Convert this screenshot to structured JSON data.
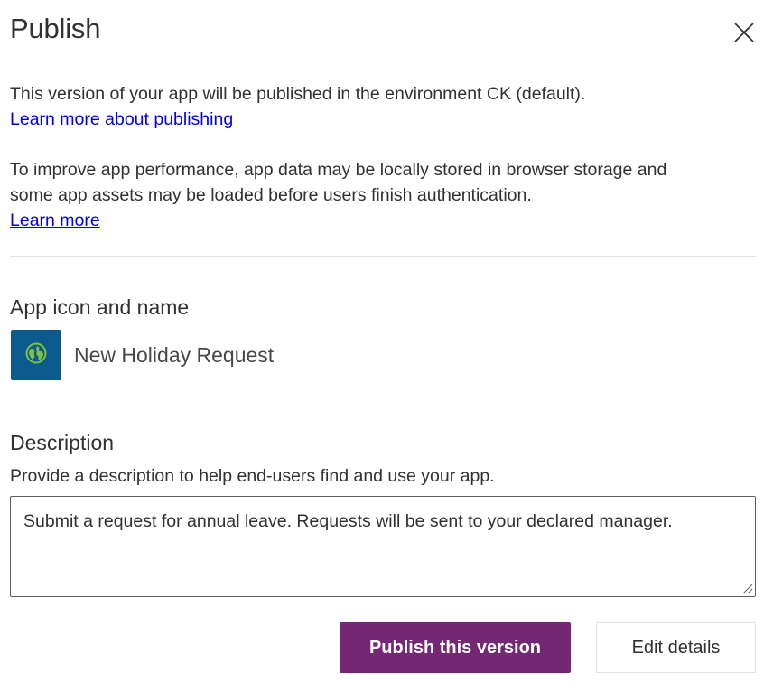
{
  "dialog": {
    "title": "Publish",
    "close_icon": "close-icon"
  },
  "intro": {
    "text": "This version of your app will be published in the environment CK (default).",
    "link": "Learn more about publishing"
  },
  "storage_notice": {
    "line1": "To improve app performance, app data may be locally stored in browser storage and",
    "line2": "some app assets may be loaded before users finish authentication.",
    "link": "Learn more"
  },
  "app_section": {
    "heading": "App icon and name",
    "icon": "globe-icon",
    "icon_bg_color": "#0b5a8e",
    "app_name": "New Holiday Request"
  },
  "description_section": {
    "heading": "Description",
    "hint": "Provide a description to help end-users find and use your app.",
    "value": "Submit a request for annual leave. Requests will be sent to your declared manager."
  },
  "actions": {
    "publish_label": "Publish this version",
    "edit_label": "Edit details",
    "primary_color": "#742774"
  }
}
